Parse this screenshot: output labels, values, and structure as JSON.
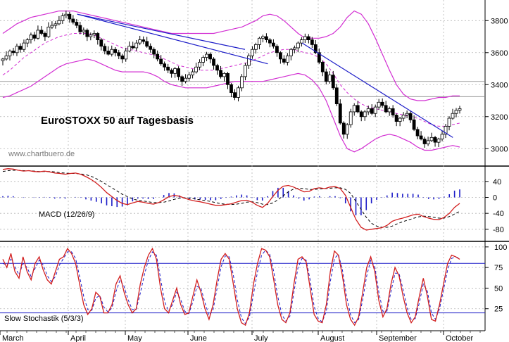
{
  "chart_data": {
    "type": "candlestick",
    "title": "EuroSTOXX 50 auf Tagesbasis",
    "watermark": "www.chartbuero.de",
    "x_months": [
      "March",
      "April",
      "May",
      "June",
      "July",
      "August",
      "September",
      "October"
    ],
    "price": {
      "ylim": [
        2900,
        3920
      ],
      "yticks": [
        3000,
        3200,
        3400,
        3600,
        3800
      ],
      "ticks_labels": [
        "3000",
        "3200",
        "3400",
        "3600",
        "3800"
      ],
      "hlines": [
        3420,
        3325
      ],
      "close": [
        3560,
        3580,
        3610,
        3600,
        3640,
        3620,
        3660,
        3680,
        3710,
        3690,
        3740,
        3720,
        3700,
        3760,
        3770,
        3780,
        3800,
        3830,
        3840,
        3810,
        3790,
        3770,
        3730,
        3740,
        3700,
        3710,
        3720,
        3680,
        3640,
        3610,
        3590,
        3620,
        3600,
        3580,
        3560,
        3610,
        3640,
        3630,
        3660,
        3680,
        3670,
        3640,
        3620,
        3590,
        3560,
        3530,
        3510,
        3490,
        3470,
        3500,
        3450,
        3420,
        3440,
        3460,
        3480,
        3510,
        3540,
        3570,
        3590,
        3560,
        3520,
        3490,
        3450,
        3470,
        3400,
        3350,
        3320,
        3380,
        3450,
        3520,
        3580,
        3620,
        3650,
        3690,
        3700,
        3680,
        3660,
        3640,
        3600,
        3560,
        3540,
        3580,
        3620,
        3630,
        3660,
        3680,
        3700,
        3680,
        3650,
        3600,
        3540,
        3480,
        3420,
        3460,
        3380,
        3280,
        3160,
        3090,
        3150,
        3230,
        3270,
        3230,
        3200,
        3230,
        3250,
        3220,
        3260,
        3290,
        3270,
        3230,
        3250,
        3210,
        3170,
        3190,
        3210,
        3220,
        3180,
        3120,
        3080,
        3060,
        3030,
        3050,
        3070,
        3040,
        3060,
        3090,
        3140,
        3190,
        3220,
        3240,
        3250
      ],
      "bollinger_upper": [
        3720,
        3750,
        3780,
        3800,
        3820,
        3830,
        3840,
        3850,
        3860,
        3860,
        3860,
        3850,
        3840,
        3830,
        3820,
        3810,
        3800,
        3790,
        3780,
        3770,
        3760,
        3750,
        3740,
        3730,
        3720,
        3720,
        3720,
        3720,
        3720,
        3720,
        3720,
        3730,
        3740,
        3750,
        3760,
        3780,
        3800,
        3830,
        3840,
        3830,
        3800,
        3760,
        3720,
        3690,
        3690,
        3690,
        3700,
        3720,
        3760,
        3820,
        3860,
        3840,
        3780,
        3690,
        3590,
        3490,
        3400,
        3340,
        3310,
        3300,
        3300,
        3310,
        3320,
        3320,
        3330,
        3330
      ],
      "bollinger_lower": [
        3320,
        3330,
        3350,
        3370,
        3390,
        3420,
        3450,
        3480,
        3510,
        3530,
        3540,
        3550,
        3560,
        3550,
        3530,
        3510,
        3490,
        3480,
        3480,
        3480,
        3480,
        3470,
        3450,
        3420,
        3400,
        3390,
        3380,
        3380,
        3380,
        3380,
        3390,
        3400,
        3410,
        3420,
        3420,
        3420,
        3420,
        3420,
        3430,
        3440,
        3450,
        3460,
        3470,
        3460,
        3430,
        3380,
        3300,
        3190,
        3080,
        3000,
        2980,
        3000,
        3030,
        3060,
        3080,
        3090,
        3080,
        3060,
        3040,
        3010,
        2990,
        2990,
        3000,
        3010,
        3020,
        3010
      ],
      "sma20": [
        3460,
        3490,
        3530,
        3570,
        3600,
        3630,
        3660,
        3680,
        3700,
        3710,
        3720,
        3720,
        3720,
        3710,
        3690,
        3670,
        3650,
        3630,
        3620,
        3610,
        3600,
        3590,
        3580,
        3560,
        3540,
        3520,
        3510,
        3500,
        3490,
        3490,
        3490,
        3500,
        3510,
        3520,
        3530,
        3540,
        3560,
        3580,
        3600,
        3610,
        3620,
        3620,
        3610,
        3600,
        3590,
        3570,
        3530,
        3470,
        3400,
        3350,
        3310,
        3280,
        3260,
        3250,
        3240,
        3230,
        3220,
        3210,
        3200,
        3190,
        3170,
        3150,
        3140,
        3140,
        3150,
        3160
      ],
      "trendlines": [
        {
          "from": [
            0.163,
            3840
          ],
          "to": [
            0.58,
            3530
          ]
        },
        {
          "from": [
            0.163,
            3840
          ],
          "to": [
            0.53,
            3620
          ]
        },
        {
          "from": [
            0.655,
            3660
          ],
          "to": [
            0.985,
            3070
          ]
        }
      ]
    },
    "macd": {
      "label": "MACD (12/26/9)",
      "ylim": [
        -105,
        75
      ],
      "yticks": [
        -80,
        -40,
        0,
        40
      ],
      "ticks_labels": [
        "-80",
        "-40",
        "0",
        "40"
      ],
      "macd": [
        70,
        72,
        71,
        68,
        66,
        67,
        65,
        64,
        66,
        64,
        61,
        60,
        58,
        60,
        61,
        58,
        52,
        45,
        36,
        25,
        12,
        2,
        -8,
        -15,
        -18,
        -14,
        -10,
        -12,
        -15,
        -17,
        -13,
        -6,
        2,
        5,
        3,
        -2,
        -6,
        -9,
        -11,
        -14,
        -17,
        -20,
        -20,
        -18,
        -16,
        -12,
        -8,
        -7,
        -12,
        -20,
        -25,
        -15,
        2,
        18,
        28,
        30,
        26,
        20,
        14,
        15,
        22,
        24,
        22,
        26,
        27,
        22,
        5,
        -25,
        -55,
        -75,
        -82,
        -80,
        -78,
        -76,
        -70,
        -60,
        -55,
        -52,
        -48,
        -44,
        -42,
        -48,
        -52,
        -55,
        -56,
        -50,
        -40,
        -25,
        -15
      ],
      "signal": [
        65,
        67,
        68,
        68,
        67,
        67,
        66,
        65,
        65,
        65,
        64,
        62,
        61,
        60,
        60,
        59,
        57,
        53,
        47,
        40,
        32,
        24,
        16,
        8,
        2,
        -4,
        -7,
        -9,
        -11,
        -13,
        -13,
        -12,
        -9,
        -5,
        -2,
        -1,
        -2,
        -4,
        -6,
        -8,
        -10,
        -13,
        -16,
        -17,
        -18,
        -17,
        -15,
        -12,
        -11,
        -13,
        -17,
        -18,
        -14,
        -6,
        4,
        14,
        21,
        23,
        22,
        20,
        20,
        21,
        22,
        23,
        24,
        24,
        20,
        10,
        -10,
        -30,
        -50,
        -65,
        -72,
        -75,
        -75,
        -72,
        -66,
        -61,
        -57,
        -53,
        -49,
        -47,
        -48,
        -50,
        -52,
        -52,
        -48,
        -42,
        -35
      ],
      "histogram": [
        3,
        4,
        3,
        0,
        -1,
        0,
        -1,
        -1,
        1,
        -1,
        -3,
        -2,
        -3,
        0,
        1,
        -1,
        -5,
        -8,
        -11,
        -15,
        -20,
        -22,
        -24,
        -23,
        -20,
        -10,
        -3,
        -3,
        -4,
        -4,
        0,
        6,
        11,
        10,
        5,
        -1,
        -4,
        -5,
        -5,
        -6,
        -7,
        -7,
        -4,
        -1,
        2,
        5,
        7,
        5,
        -1,
        -7,
        -8,
        3,
        16,
        24,
        24,
        16,
        5,
        -3,
        -8,
        -5,
        2,
        3,
        0,
        3,
        3,
        -2,
        -15,
        -35,
        -45,
        -45,
        -32,
        -15,
        -6,
        -1,
        5,
        12,
        11,
        9,
        9,
        9,
        7,
        -1,
        -4,
        -5,
        -4,
        2,
        8,
        17,
        20
      ]
    },
    "stochastic": {
      "label": "Slow Stochastik (5/3/3)",
      "ylim": [
        0,
        105
      ],
      "yticks": [
        25,
        50,
        75,
        100
      ],
      "ticks_labels": [
        "25",
        "50",
        "75",
        "100"
      ],
      "hlines": [
        80,
        20
      ],
      "k": [
        85,
        75,
        92,
        70,
        62,
        88,
        70,
        60,
        80,
        88,
        72,
        60,
        55,
        70,
        85,
        88,
        98,
        92,
        80,
        55,
        30,
        18,
        25,
        45,
        40,
        20,
        20,
        30,
        55,
        65,
        45,
        30,
        20,
        25,
        55,
        75,
        90,
        98,
        85,
        50,
        25,
        20,
        35,
        50,
        30,
        18,
        20,
        40,
        60,
        45,
        25,
        12,
        30,
        60,
        85,
        92,
        85,
        55,
        25,
        8,
        5,
        20,
        55,
        80,
        98,
        96,
        88,
        60,
        30,
        12,
        8,
        20,
        55,
        85,
        88,
        82,
        50,
        18,
        10,
        8,
        30,
        70,
        95,
        90,
        65,
        30,
        12,
        5,
        15,
        45,
        75,
        88,
        70,
        35,
        15,
        25,
        55,
        75,
        65,
        40,
        20,
        8,
        15,
        40,
        62,
        40,
        12,
        10,
        30,
        55,
        80,
        90,
        88,
        85
      ],
      "d": [
        80,
        78,
        85,
        76,
        66,
        80,
        75,
        64,
        74,
        84,
        78,
        65,
        58,
        64,
        78,
        86,
        94,
        94,
        86,
        64,
        40,
        24,
        23,
        38,
        41,
        27,
        21,
        26,
        46,
        60,
        52,
        36,
        24,
        24,
        44,
        66,
        84,
        94,
        90,
        62,
        34,
        22,
        30,
        45,
        36,
        22,
        19,
        33,
        52,
        50,
        32,
        17,
        24,
        50,
        76,
        89,
        88,
        66,
        36,
        14,
        7,
        15,
        43,
        70,
        90,
        96,
        91,
        70,
        40,
        18,
        10,
        16,
        45,
        75,
        86,
        84,
        60,
        28,
        13,
        9,
        22,
        58,
        86,
        91,
        72,
        40,
        18,
        8,
        12,
        36,
        65,
        84,
        76,
        45,
        22,
        22,
        46,
        68,
        68,
        48,
        26,
        12,
        13,
        32,
        55,
        46,
        20,
        12,
        25,
        48,
        72,
        86,
        88,
        86
      ]
    }
  }
}
